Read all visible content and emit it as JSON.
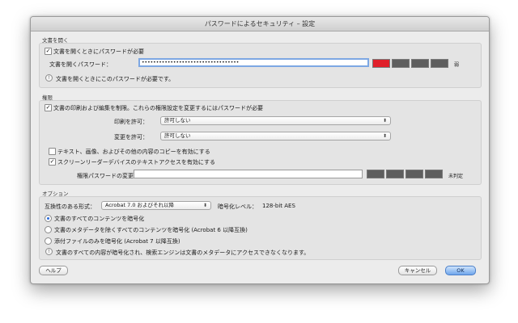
{
  "dialog": {
    "title": "パスワードによるセキュリティ – 設定"
  },
  "open_section": {
    "heading": "文書を開く",
    "require_checkbox": {
      "label": "文書を開くときにパスワードが必要",
      "checked": true
    },
    "password_label": "文書を開くパスワード：",
    "password_value": "••••••••••••••••••••••••••••••••••",
    "strength_label": "弱",
    "strength_level": 1,
    "strength_segments": 4,
    "strength_color": "#e0202a",
    "note": "文書を開くときにこのパスワードが必要です。"
  },
  "permissions_section": {
    "heading": "権限",
    "restrict_checkbox": {
      "label": "文書の印刷および編集を制限。これらの権限設定を変更するにはパスワードが必要",
      "checked": true
    },
    "print_label": "印刷を許可：",
    "print_value": "許可しない",
    "change_label": "変更を許可：",
    "change_value": "許可しない",
    "copy_checkbox": {
      "label": "テキスト、画像、およびその他の内容のコピーを有効にする",
      "checked": false
    },
    "screenreader_checkbox": {
      "label": "スクリーンリーダーデバイスのテキストアクセスを有効にする",
      "checked": true
    },
    "perm_password_label": "権限パスワードの変更：",
    "perm_password_value": "",
    "strength_label": "未判定",
    "strength_level": 0,
    "strength_segments": 4
  },
  "options_section": {
    "heading": "オプション",
    "compat_label": "互換性のある形式：",
    "compat_value": "Acrobat 7.0 およびそれ以降",
    "encryption_label": "暗号化レベル：",
    "encryption_value": "128-bit AES",
    "radios": [
      {
        "label": "文書のすべてのコンテンツを暗号化",
        "selected": true
      },
      {
        "label": "文書のメタデータを除くすべてのコンテンツを暗号化 (Acrobat 6 以降互換)",
        "selected": false
      },
      {
        "label": "添付ファイルのみを暗号化 (Acrobat 7 以降互換)",
        "selected": false
      }
    ],
    "note": "文書のすべての内容が暗号化され、検索エンジンは文書のメタデータにアクセスできなくなります。"
  },
  "footer": {
    "help_label": "ヘルプ",
    "cancel_label": "キャンセル",
    "ok_label": "OK"
  },
  "colors": {
    "strength_empty": "#5e5e5e",
    "accent": "#6fa6ec"
  }
}
